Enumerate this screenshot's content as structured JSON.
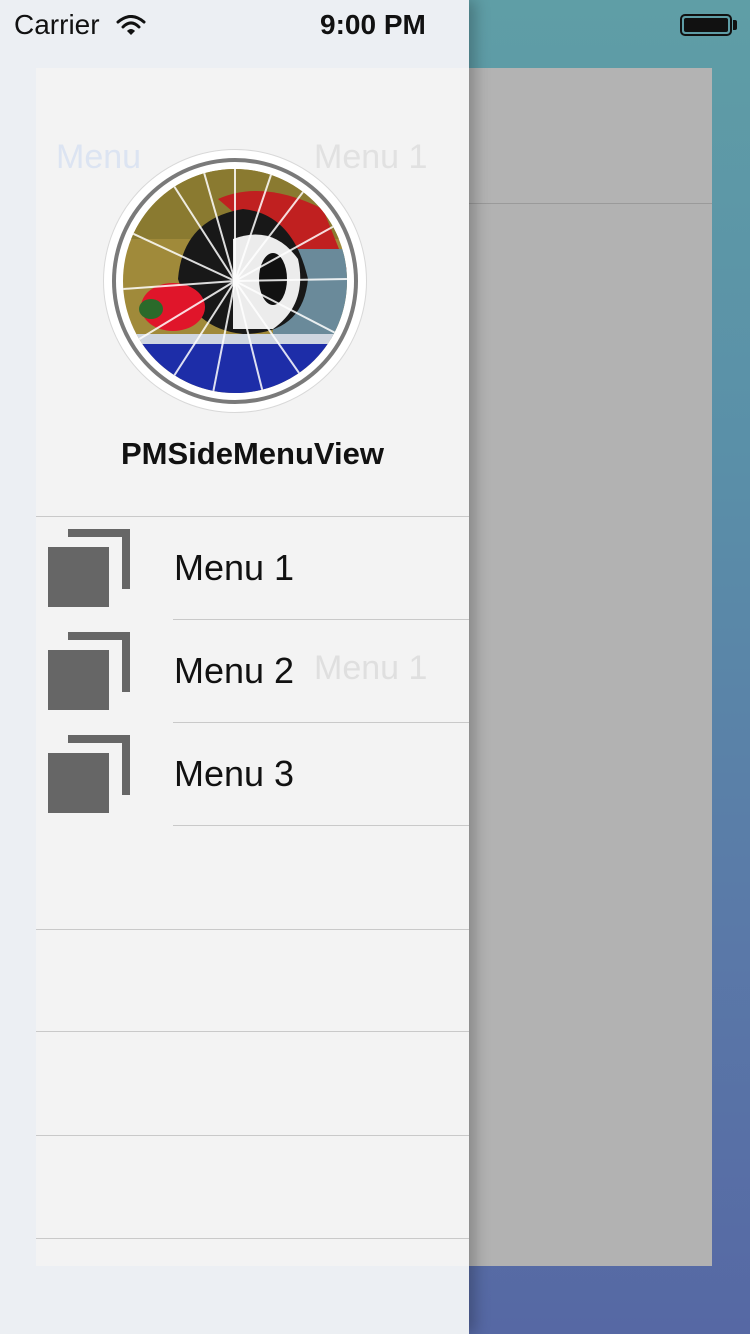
{
  "status_bar": {
    "carrier": "Carrier",
    "time": "9:00 PM"
  },
  "background_view": {
    "nav_left": "Menu",
    "nav_title": "Menu 1",
    "body_text": "Menu 1"
  },
  "profile": {
    "name": "PMSideMenuView"
  },
  "menu": {
    "items": [
      {
        "label": "Menu 1",
        "icon": "windows-icon"
      },
      {
        "label": "Menu 2",
        "icon": "windows-icon"
      },
      {
        "label": "Menu 3",
        "icon": "windows-icon"
      }
    ]
  },
  "colors": {
    "panel": "#f3f3f3",
    "content_dim": "#b2b2b2",
    "icon": "#666666",
    "text": "#111111"
  }
}
